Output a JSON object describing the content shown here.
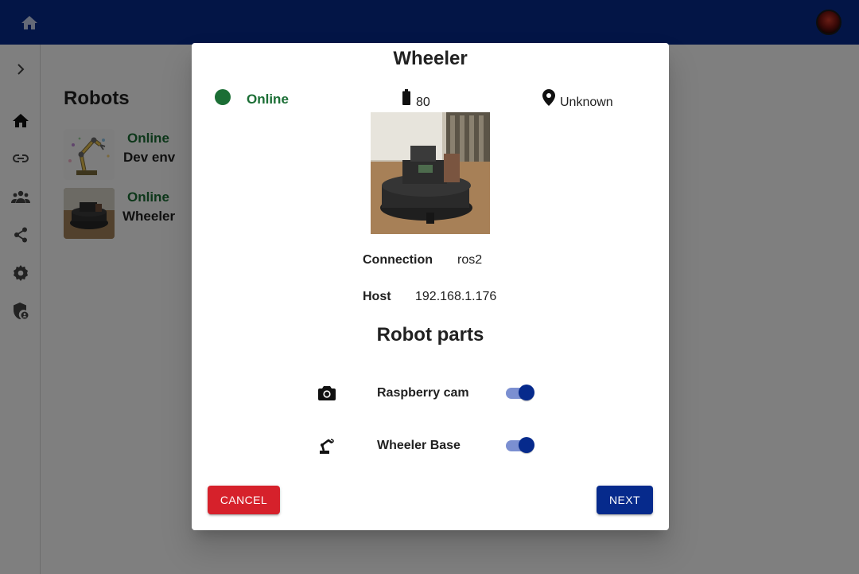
{
  "app": {
    "home_icon": "home-icon",
    "avatar_icon": "user-avatar"
  },
  "sidebar": {
    "items": [
      {
        "icon": "chevron-right-icon"
      },
      {
        "icon": "home-icon"
      },
      {
        "icon": "link-icon"
      },
      {
        "icon": "people-icon"
      },
      {
        "icon": "share-icon"
      },
      {
        "icon": "gear-icon"
      },
      {
        "icon": "admin-shield-icon"
      }
    ]
  },
  "main": {
    "title": "Robots",
    "robots": [
      {
        "status": "Online",
        "name": "Dev env"
      },
      {
        "status": "Online",
        "name": "Wheeler"
      }
    ]
  },
  "dialog": {
    "title": "Wheeler",
    "status": "Online",
    "battery": "80",
    "location": "Unknown",
    "connection_label": "Connection",
    "connection_value": "ros2",
    "host_label": "Host",
    "host_value": "192.168.1.176",
    "parts_title": "Robot parts",
    "parts": [
      {
        "icon": "camera-icon",
        "label": "Raspberry cam",
        "enabled": true
      },
      {
        "icon": "robot-arm-icon",
        "label": "Wheeler Base",
        "enabled": true
      }
    ],
    "cancel_label": "CANCEL",
    "next_label": "NEXT"
  },
  "colors": {
    "primary": "#062a8c",
    "online": "#1b6e35",
    "cancel": "#d6212b"
  }
}
